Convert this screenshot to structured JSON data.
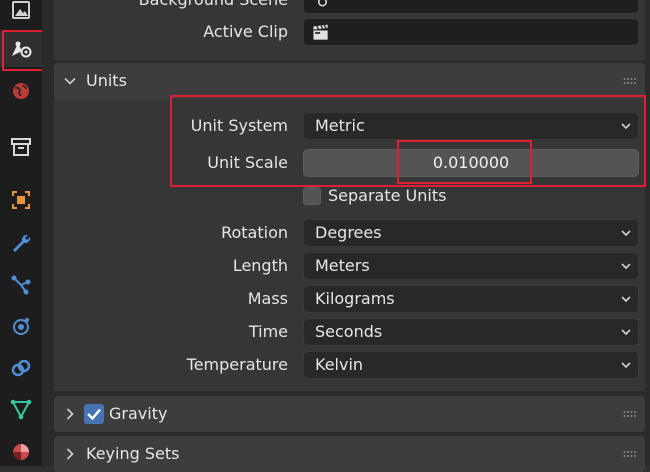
{
  "sidebar": {
    "tabs": [
      {
        "icon": "image-icon"
      },
      {
        "icon": "scene-icon",
        "active": true
      },
      {
        "icon": "world-icon"
      },
      {
        "icon": "collection-icon"
      },
      {
        "icon": "object-icon"
      },
      {
        "icon": "modifier-wrench-icon"
      },
      {
        "icon": "particles-icon"
      },
      {
        "icon": "physics-icon"
      },
      {
        "icon": "constraints-icon"
      },
      {
        "icon": "object-data-icon"
      },
      {
        "icon": "material-icon"
      }
    ]
  },
  "scene_props": {
    "background_scene_label": "Background Scene",
    "active_clip_label": "Active Clip"
  },
  "units_panel": {
    "title": "Units",
    "unit_system_label": "Unit System",
    "unit_system_value": "Metric",
    "unit_scale_label": "Unit Scale",
    "unit_scale_value": "0.010000",
    "separate_units_label": "Separate Units",
    "separate_units_checked": false,
    "rotation_label": "Rotation",
    "rotation_value": "Degrees",
    "length_label": "Length",
    "length_value": "Meters",
    "mass_label": "Mass",
    "mass_value": "Kilograms",
    "time_label": "Time",
    "time_value": "Seconds",
    "temperature_label": "Temperature",
    "temperature_value": "Kelvin"
  },
  "gravity_panel": {
    "title": "Gravity",
    "checked": true
  },
  "keying_sets_panel": {
    "title": "Keying Sets"
  },
  "colors": {
    "highlight": "#e02030",
    "checkbox_checked": "#4772b3"
  }
}
